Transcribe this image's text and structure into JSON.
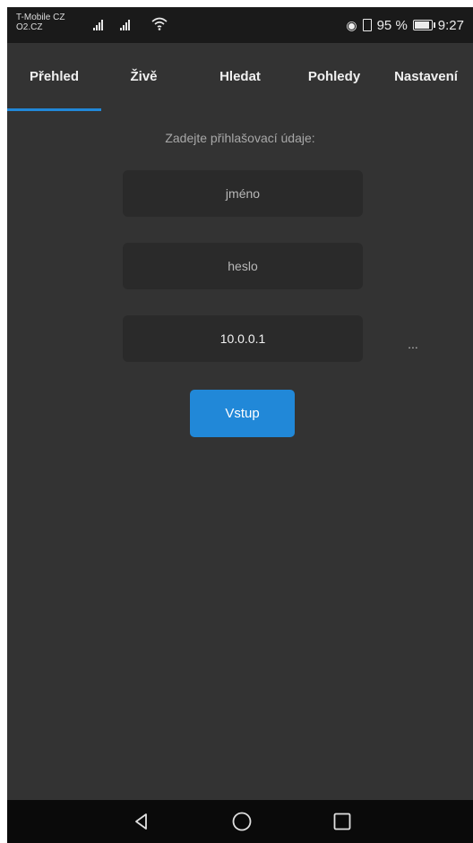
{
  "status_bar": {
    "carrier_line1": "T-Mobile CZ",
    "carrier_line2": "O2.CZ",
    "battery_percent": "95 %",
    "battery_level": 0.95,
    "time": "9:27",
    "icons": [
      "signal-icon",
      "wifi-icon",
      "eye-comfort-icon",
      "vibrate-icon",
      "battery-icon"
    ]
  },
  "tabs": [
    {
      "label": "Přehled",
      "active": true
    },
    {
      "label": "Živě",
      "active": false
    },
    {
      "label": "Hledat",
      "active": false
    },
    {
      "label": "Pohledy",
      "active": false
    },
    {
      "label": "Nastavení",
      "active": false
    }
  ],
  "login": {
    "prompt": "Zadejte přihlašovací údaje:",
    "username_placeholder": "jméno",
    "password_placeholder": "heslo",
    "server_value": "10.0.0.1",
    "more_label": "...",
    "submit_label": "Vstup"
  },
  "nav": {
    "icons": [
      "back-icon",
      "home-icon",
      "recents-icon"
    ]
  },
  "colors": {
    "background": "#333333",
    "field": "#2a2a2a",
    "accent": "#2188d8",
    "status_bar": "#1a1a1a",
    "nav_bar": "#0a0a0a"
  }
}
